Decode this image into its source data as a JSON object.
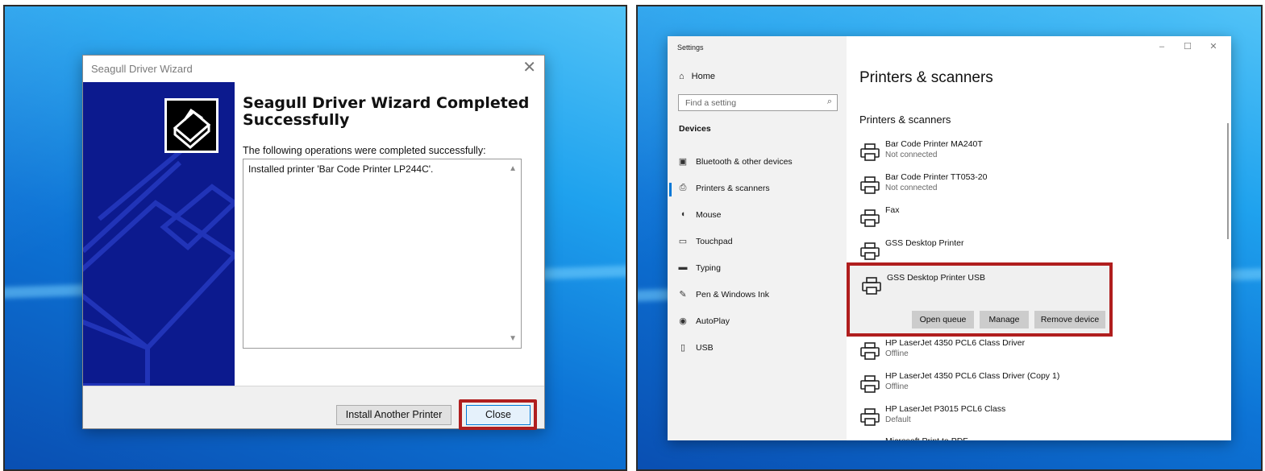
{
  "wizard": {
    "title": "Seagull Driver Wizard",
    "close_glyph": "✕",
    "heading": "Seagull Driver Wizard Completed Successfully",
    "subheading": "The following operations were completed successfully:",
    "log_text": "Installed printer 'Bar Code Printer LP244C'.",
    "install_another_label": "Install Another Printer",
    "close_label": "Close"
  },
  "settings": {
    "app_title": "Settings",
    "window_controls": [
      "–",
      "☐",
      "✕"
    ],
    "sidebar": {
      "home_label": "Home",
      "search_placeholder": "Find a setting",
      "section_label": "Devices",
      "items": [
        {
          "label": "Bluetooth & other devices",
          "icon": "bluetooth-devices-icon",
          "glyph": "▣"
        },
        {
          "label": "Printers & scanners",
          "icon": "printer-icon",
          "glyph": "⎙"
        },
        {
          "label": "Mouse",
          "icon": "mouse-icon",
          "glyph": "◖"
        },
        {
          "label": "Touchpad",
          "icon": "touchpad-icon",
          "glyph": "▭"
        },
        {
          "label": "Typing",
          "icon": "keyboard-icon",
          "glyph": "▬"
        },
        {
          "label": "Pen & Windows Ink",
          "icon": "pen-icon",
          "glyph": "✎"
        },
        {
          "label": "AutoPlay",
          "icon": "autoplay-icon",
          "glyph": "◉"
        },
        {
          "label": "USB",
          "icon": "usb-icon",
          "glyph": "▯"
        }
      ],
      "active_index": 1
    },
    "main": {
      "title": "Printers & scanners",
      "section_title": "Printers & scanners",
      "printers": [
        {
          "name": "Bar Code Printer MA240T",
          "status": "Not connected"
        },
        {
          "name": "Bar Code Printer TT053-20",
          "status": "Not connected"
        },
        {
          "name": "Fax",
          "status": ""
        },
        {
          "name": "GSS Desktop Printer",
          "status": ""
        },
        {
          "name": "GSS Desktop Printer USB",
          "status": ""
        },
        {
          "name": "HP LaserJet 4350 PCL6 Class Driver",
          "status": "Offline"
        },
        {
          "name": "HP LaserJet 4350 PCL6 Class Driver (Copy 1)",
          "status": "Offline"
        },
        {
          "name": "HP LaserJet P3015 PCL6 Class",
          "status": "Default"
        },
        {
          "name": "Microsoft Print to PDF",
          "status": ""
        }
      ],
      "selected_actions": {
        "open_queue_label": "Open queue",
        "manage_label": "Manage",
        "remove_label": "Remove device"
      }
    }
  }
}
